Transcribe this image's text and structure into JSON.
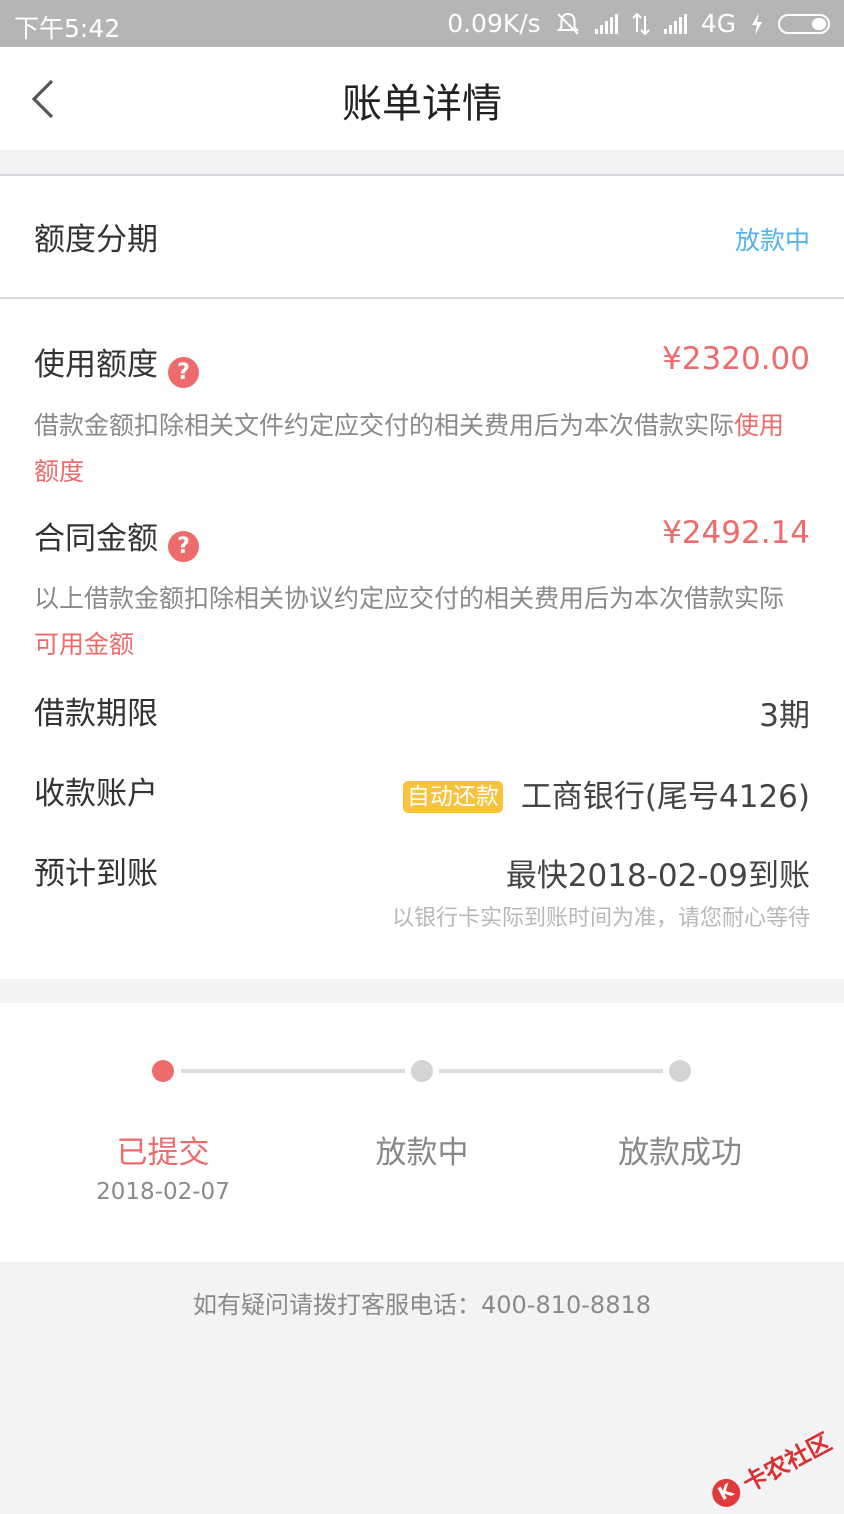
{
  "status_bar": {
    "time": "下午5:42",
    "speed": "0.09K/s",
    "network": "4G",
    "icons": [
      "mute-bell-icon",
      "signal-icon",
      "data-arrows-icon",
      "signal-icon",
      "charging-icon",
      "battery-icon"
    ]
  },
  "nav": {
    "back_icon": "chevron-left-icon",
    "title": "账单详情"
  },
  "loan_type": {
    "label": "额度分期",
    "status": "放款中"
  },
  "usage_amount": {
    "label": "使用额度",
    "value": "¥2320.00",
    "help_icon": "question-circle-icon",
    "help_icon_glyph": "?",
    "note_prefix": "借款金额扣除相关文件约定应交付的相关费用后为本次借款实际",
    "note_highlight": "使用额度"
  },
  "contract_amount": {
    "label": "合同金额",
    "value": "¥2492.14",
    "help_icon": "question-circle-icon",
    "help_icon_glyph": "?",
    "note_prefix": "以上借款金额扣除相关协议约定应交付的相关费用后为本次借款实际",
    "note_highlight": "可用金额"
  },
  "term": {
    "label": "借款期限",
    "value": "3期"
  },
  "account": {
    "label": "收款账户",
    "badge": "自动还款",
    "value": "工商银行(尾号4126)"
  },
  "arrival": {
    "label": "预计到账",
    "value": "最快2018-02-09到账",
    "tip": "以银行卡实际到账时间为准，请您耐心等待"
  },
  "progress": {
    "steps": [
      {
        "label": "已提交",
        "date": "2018-02-07",
        "state": "done"
      },
      {
        "label": "放款中",
        "date": "",
        "state": "pending"
      },
      {
        "label": "放款成功",
        "date": "",
        "state": "pending"
      }
    ]
  },
  "footer": {
    "contact": "如有疑问请拨打客服电话：400-810-8818"
  },
  "watermark": {
    "mark": "K",
    "text": "卡农社区"
  },
  "colors": {
    "accent_red": "#ee6b6b",
    "link_blue": "#55b3e8",
    "badge_yellow": "#f7c23c",
    "status_bar": "#b5b5b7",
    "page_bg": "#f3f3f6"
  }
}
